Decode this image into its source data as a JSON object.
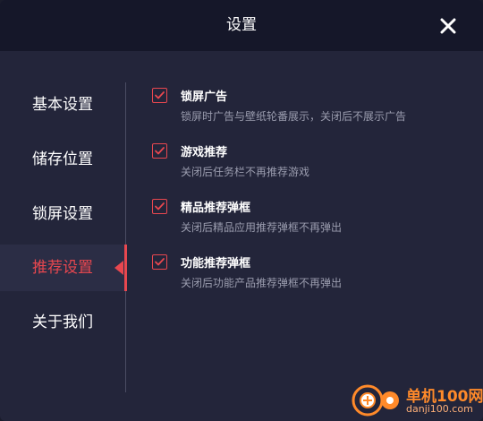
{
  "window": {
    "title": "设置",
    "close_icon": "close-icon"
  },
  "colors": {
    "accent": "#e8474f",
    "background": "#23253a",
    "titlebar": "#151729",
    "text": "#ffffff",
    "muted_text": "#9a9cae"
  },
  "sidebar": {
    "items": [
      {
        "label": "基本设置",
        "active": false
      },
      {
        "label": "储存位置",
        "active": false
      },
      {
        "label": "锁屏设置",
        "active": false
      },
      {
        "label": "推荐设置",
        "active": true
      },
      {
        "label": "关于我们",
        "active": false
      }
    ]
  },
  "options": [
    {
      "title": "锁屏广告",
      "desc": "锁屏时广告与壁纸轮番展示，关闭后不展示广告",
      "checked": true
    },
    {
      "title": "游戏推荐",
      "desc": "关闭后任务栏不再推荐游戏",
      "checked": true
    },
    {
      "title": "精品推荐弹框",
      "desc": "关闭后精品应用推荐弹框不再弹出",
      "checked": true
    },
    {
      "title": "功能推荐弹框",
      "desc": "关闭后功能产品推荐弹框不再弹出",
      "checked": true
    }
  ],
  "watermark": {
    "title": "单机100网",
    "url": "danji100.com"
  }
}
